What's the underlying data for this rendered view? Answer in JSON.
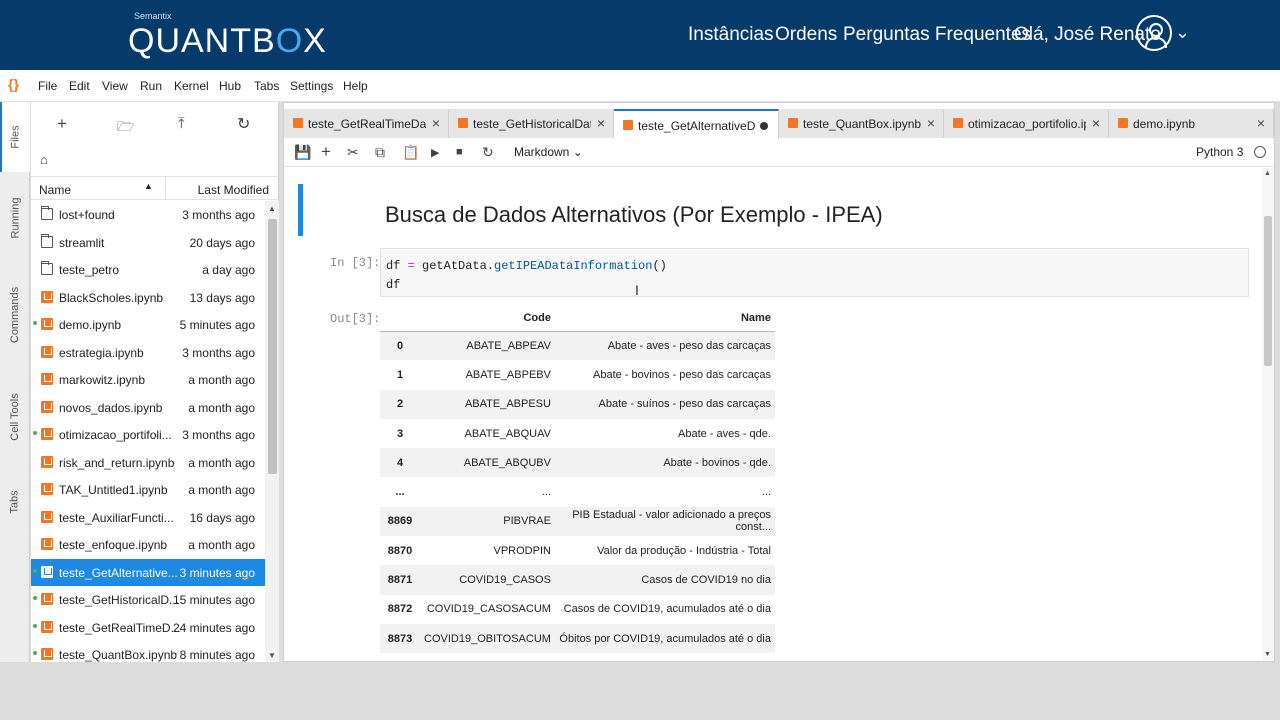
{
  "brand": {
    "small": "Semantix",
    "logo_main": "QUANTB",
    "logo_accent": "O",
    "logo_end": "X"
  },
  "nav": {
    "instancias": "Instâncias",
    "ordens": "Ordens",
    "faq": "Perguntas Frequentes",
    "greeting": "Olá, José Renato"
  },
  "menu": [
    "File",
    "Edit",
    "View",
    "Run",
    "Kernel",
    "Hub",
    "Tabs",
    "Settings",
    "Help"
  ],
  "sidetabs": [
    "Files",
    "Running",
    "Commands",
    "Cell Tools",
    "Tabs"
  ],
  "filebrowser": {
    "col_name": "Name",
    "col_modified": "Last Modified",
    "files": [
      {
        "name": "lost+found",
        "modified": "3 months ago",
        "type": "folder",
        "running": false
      },
      {
        "name": "streamlit",
        "modified": "20 days ago",
        "type": "folder",
        "running": false
      },
      {
        "name": "teste_petro",
        "modified": "a day ago",
        "type": "folder",
        "running": false
      },
      {
        "name": "BlackScholes.ipynb",
        "modified": "13 days ago",
        "type": "notebook",
        "running": false
      },
      {
        "name": "demo.ipynb",
        "modified": "5 minutes ago",
        "type": "notebook",
        "running": true
      },
      {
        "name": "estrategia.ipynb",
        "modified": "3 months ago",
        "type": "notebook",
        "running": false
      },
      {
        "name": "markowitz.ipynb",
        "modified": "a month ago",
        "type": "notebook",
        "running": false
      },
      {
        "name": "novos_dados.ipynb",
        "modified": "a month ago",
        "type": "notebook",
        "running": false
      },
      {
        "name": "otimizacao_portifoli...",
        "modified": "3 months ago",
        "type": "notebook",
        "running": true
      },
      {
        "name": "risk_and_return.ipynb",
        "modified": "a month ago",
        "type": "notebook",
        "running": false
      },
      {
        "name": "TAK_Untitled1.ipynb",
        "modified": "a month ago",
        "type": "notebook",
        "running": false
      },
      {
        "name": "teste_AuxiliarFuncti...",
        "modified": "16 days ago",
        "type": "notebook",
        "running": false
      },
      {
        "name": "teste_enfoque.ipynb",
        "modified": "a month ago",
        "type": "notebook",
        "running": false
      },
      {
        "name": "teste_GetAlternative...",
        "modified": "3 minutes ago",
        "type": "notebook",
        "running": true,
        "selected": true
      },
      {
        "name": "teste_GetHistoricalD...",
        "modified": "15 minutes ago",
        "type": "notebook",
        "running": true
      },
      {
        "name": "teste_GetRealTimeD...",
        "modified": "24 minutes ago",
        "type": "notebook",
        "running": true
      },
      {
        "name": "teste_QuantBox.ipynb",
        "modified": "8 minutes ago",
        "type": "notebook",
        "running": true
      }
    ]
  },
  "tabs": [
    {
      "label": "teste_GetRealTimeData.ip",
      "active": false,
      "dirty": false
    },
    {
      "label": "teste_GetHistoricalData.ip",
      "active": false,
      "dirty": false
    },
    {
      "label": "teste_GetAlternativeData.",
      "active": true,
      "dirty": true
    },
    {
      "label": "teste_QuantBox.ipynb",
      "active": false,
      "dirty": false
    },
    {
      "label": "otimizacao_portifolio.ipyr",
      "active": false,
      "dirty": false
    },
    {
      "label": "demo.ipynb",
      "active": false,
      "dirty": false
    }
  ],
  "toolbar": {
    "cell_type": "Markdown",
    "kernel": "Python 3"
  },
  "notebook": {
    "heading": "Busca de Dados Alternativos (Por Exemplo - IPEA)",
    "in_prompt": "In [3]:",
    "code_line1_var": "df",
    "code_line1_op": "=",
    "code_line1_obj": "getAtData.",
    "code_line1_fn": "getIPEADataInformation",
    "code_line1_parens": "()",
    "code_line2": "df",
    "out_prompt": "Out[3]:",
    "table": {
      "headers": [
        "",
        "Code",
        "Name"
      ],
      "rows": [
        [
          "0",
          "ABATE_ABPEAV",
          "Abate - aves - peso das carcaças"
        ],
        [
          "1",
          "ABATE_ABPEBV",
          "Abate - bovinos - peso das carcaças"
        ],
        [
          "2",
          "ABATE_ABPESU",
          "Abate - suínos - peso das carcaças"
        ],
        [
          "3",
          "ABATE_ABQUAV",
          "Abate - aves - qde."
        ],
        [
          "4",
          "ABATE_ABQUBV",
          "Abate - bovinos - qde."
        ],
        [
          "...",
          "...",
          "..."
        ],
        [
          "8869",
          "PIBVRAE",
          "PIB Estadual - valor adicionado a preços const..."
        ],
        [
          "8870",
          "VPRODPIN",
          "Valor da produção - Indústria - Total"
        ],
        [
          "8871",
          "COVID19_CASOS",
          "Casos de COVID19 no dia"
        ],
        [
          "8872",
          "COVID19_CASOSACUM",
          "Casos de COVID19, acumulados até o dia"
        ],
        [
          "8873",
          "COVID19_OBITOSACUM",
          "Óbitos por COVID19, acumulados até o dia"
        ]
      ]
    }
  },
  "colors": {
    "brand_bg": "#053a6b",
    "accent": "#1e88e5",
    "notebook_icon": "#f37626"
  }
}
